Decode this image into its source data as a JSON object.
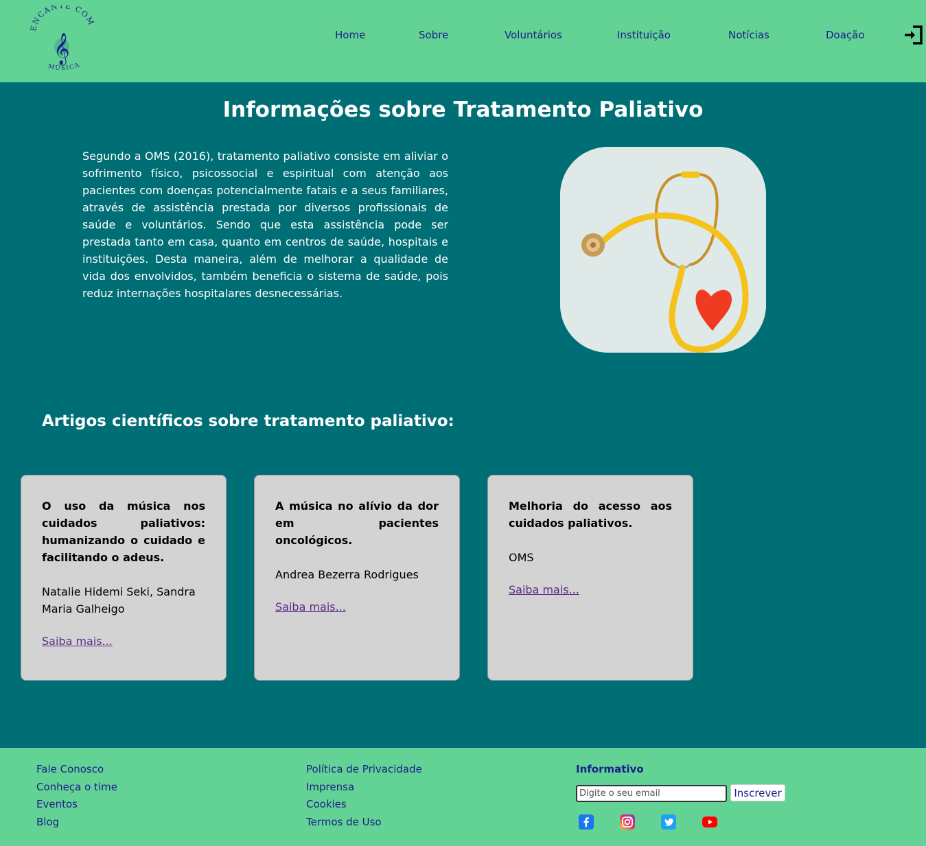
{
  "header": {
    "logo_top_text": "ENCANTE COM",
    "logo_bottom_text": "MÚSICA",
    "nav": [
      {
        "label": "Home"
      },
      {
        "label": "Sobre"
      },
      {
        "label": "Voluntários"
      },
      {
        "label": "Instituição"
      },
      {
        "label": "Notícias"
      },
      {
        "label": "Doação"
      }
    ],
    "login_icon": "sign-in-icon"
  },
  "main": {
    "title": "Informações sobre Tratamento Paliativo",
    "intro": "Segundo a OMS (2016), tratamento paliativo consiste em aliviar o sofrimento físico, psicossocial e espiritual com atenção aos pacientes com doenças potencialmente fatais e a seus familiares, através de assistência prestada por diversos profissionais de saúde e voluntários. Sendo que esta assistência pode ser prestada tanto em casa, quanto em centros de saúde, hospitais e instituições. Desta maneira, além de melhorar a qualidade de vida dos envolvidos, também beneficia o sistema de saúde, pois reduz internações hospitalares desnecessárias.",
    "hero_image": "stethoscope-heart-image",
    "articles_title": "Artigos científicos sobre tratamento paliativo:",
    "articles": [
      {
        "title": "O uso da música nos cuidados paliativos: humanizando o cuidado e facilitando o adeus.",
        "author": "Natalie Hidemi Seki, Sandra Maria Galheigo",
        "link": "Saiba mais..."
      },
      {
        "title": "A música no alívio da dor em pacientes oncológicos.",
        "author": "Andrea Bezerra Rodrigues",
        "link": "Saiba mais..."
      },
      {
        "title": "Melhoria do acesso aos cuidados paliativos.",
        "author": "OMS",
        "link": "Saiba mais..."
      }
    ]
  },
  "footer": {
    "col1": [
      "Fale Conosco",
      "Conheça o time",
      "Eventos",
      "Blog"
    ],
    "col2": [
      "Política de Privacidade",
      "Imprensa",
      "Cookies",
      "Termos de Uso"
    ],
    "newsletter_heading": "Informativo",
    "email_placeholder": "Digite o seu email",
    "subscribe_label": "Inscrever",
    "social": [
      "facebook-icon",
      "instagram-icon",
      "twitter-icon",
      "youtube-icon"
    ]
  },
  "colors": {
    "header_bg": "#62d394",
    "main_bg": "#006e75",
    "card_bg": "#d3d3d3",
    "nav_text": "#1d1d8c",
    "link": "#5a2a86"
  }
}
